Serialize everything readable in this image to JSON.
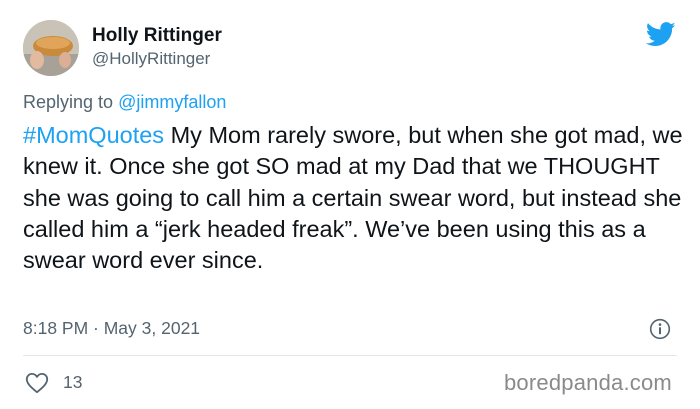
{
  "tweet": {
    "author_name": "Holly Rittinger",
    "author_handle": "@HollyRittinger",
    "reply_prefix": "Replying to",
    "reply_to": "@jimmyfallon",
    "hashtag": "#MomQuotes",
    "body": "  My Mom rarely swore, but when she got mad, we knew it.  Once she got SO mad at my Dad that we THOUGHT she was going to call him a certain swear word, but instead she called him a “jerk headed freak”.  We’ve been using this as a swear word ever since.",
    "timestamp": "8:18 PM · May 3, 2021",
    "like_count": "13"
  },
  "watermark": "boredpanda.com",
  "icons": {
    "brand": "twitter-bird-icon",
    "info": "info-icon",
    "like": "heart-icon"
  },
  "colors": {
    "accent": "#1da1f2",
    "text": "#0f1419",
    "secondary": "#536471",
    "divider": "#e1e8ed",
    "watermark": "#8a8a8a"
  }
}
